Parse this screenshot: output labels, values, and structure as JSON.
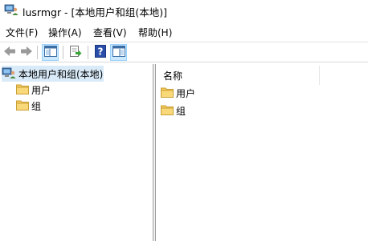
{
  "window": {
    "title": "lusrmgr - [本地用户和组(本地)]"
  },
  "menu": {
    "file": "文件(F)",
    "action": "操作(A)",
    "view": "查看(V)",
    "help": "帮助(H)"
  },
  "toolbar": {
    "icons": [
      "back-arrow-icon",
      "forward-arrow-icon",
      "show-hide-tree-icon",
      "export-list-icon",
      "help-icon",
      "show-hide-action-pane-icon"
    ]
  },
  "tree": {
    "root_label": "本地用户和组(本地)",
    "children": [
      {
        "label": "用户"
      },
      {
        "label": "组"
      }
    ]
  },
  "list": {
    "column_name": "名称",
    "items": [
      {
        "label": "用户"
      },
      {
        "label": "组"
      }
    ]
  },
  "colors": {
    "selection": "#d9ebf9",
    "pressed_button": "#cce8ff",
    "folder": "#f4c95d"
  }
}
